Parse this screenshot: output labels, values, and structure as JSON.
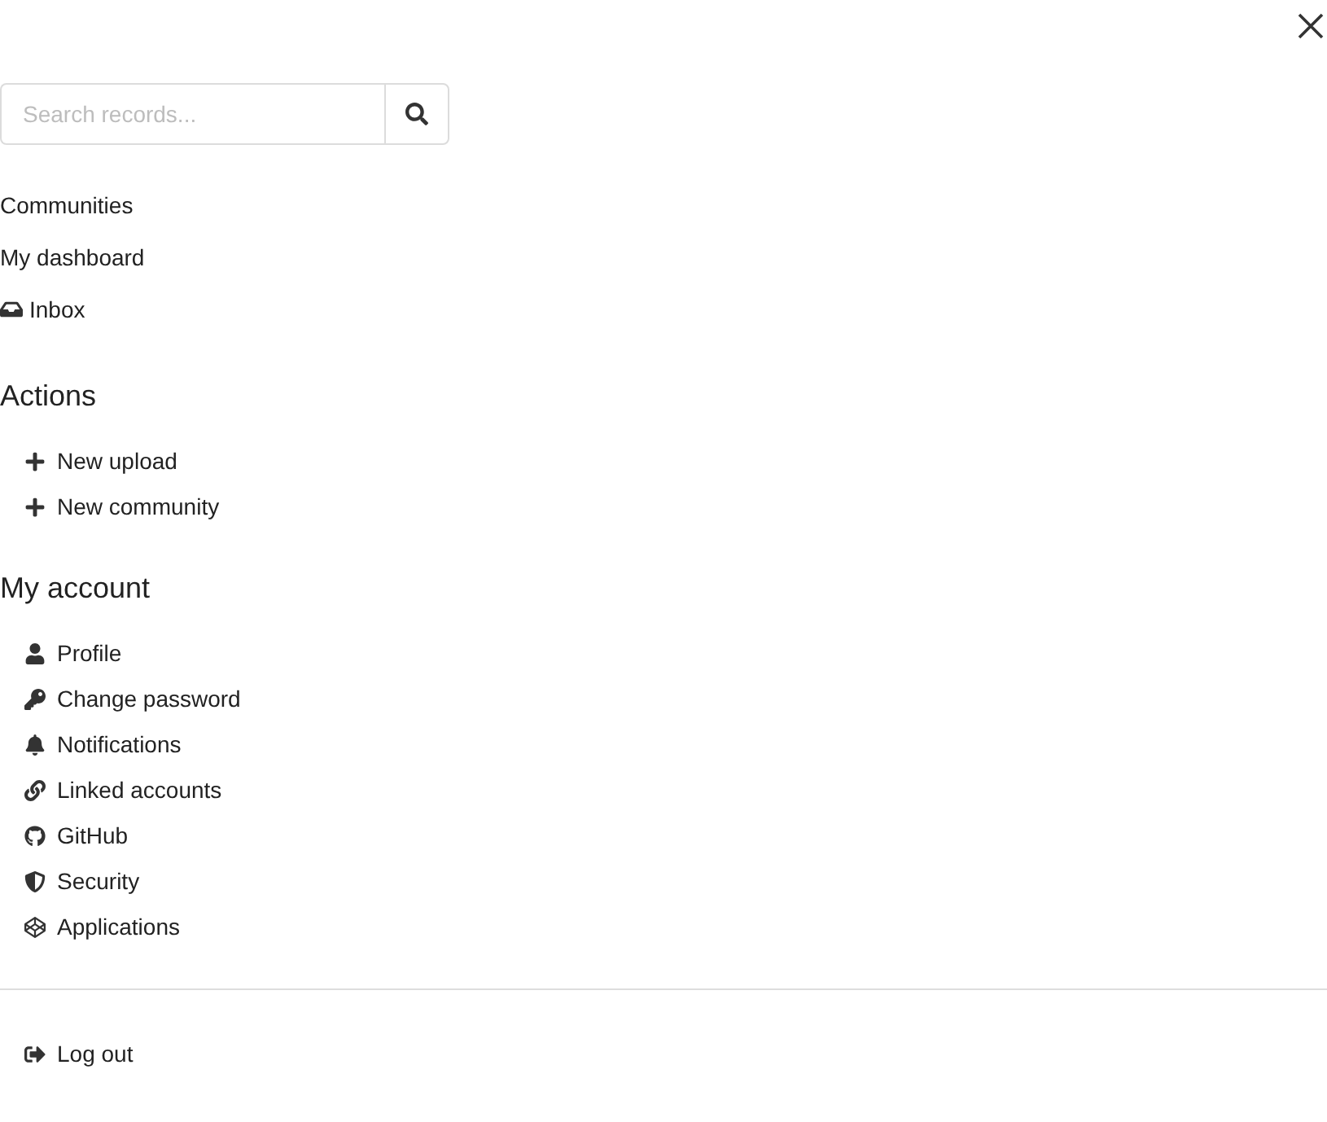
{
  "search": {
    "placeholder": "Search records..."
  },
  "nav_links": [
    {
      "label": "Communities"
    },
    {
      "label": "My dashboard"
    },
    {
      "label": "Inbox"
    }
  ],
  "sections": [
    {
      "title": "Actions",
      "items": [
        {
          "label": "New upload"
        },
        {
          "label": "New community"
        }
      ]
    },
    {
      "title": "My account",
      "items": [
        {
          "label": "Profile"
        },
        {
          "label": "Change password"
        },
        {
          "label": "Notifications"
        },
        {
          "label": "Linked accounts"
        },
        {
          "label": "GitHub"
        },
        {
          "label": "Security"
        },
        {
          "label": "Applications"
        }
      ]
    }
  ],
  "logout": {
    "label": "Log out"
  }
}
